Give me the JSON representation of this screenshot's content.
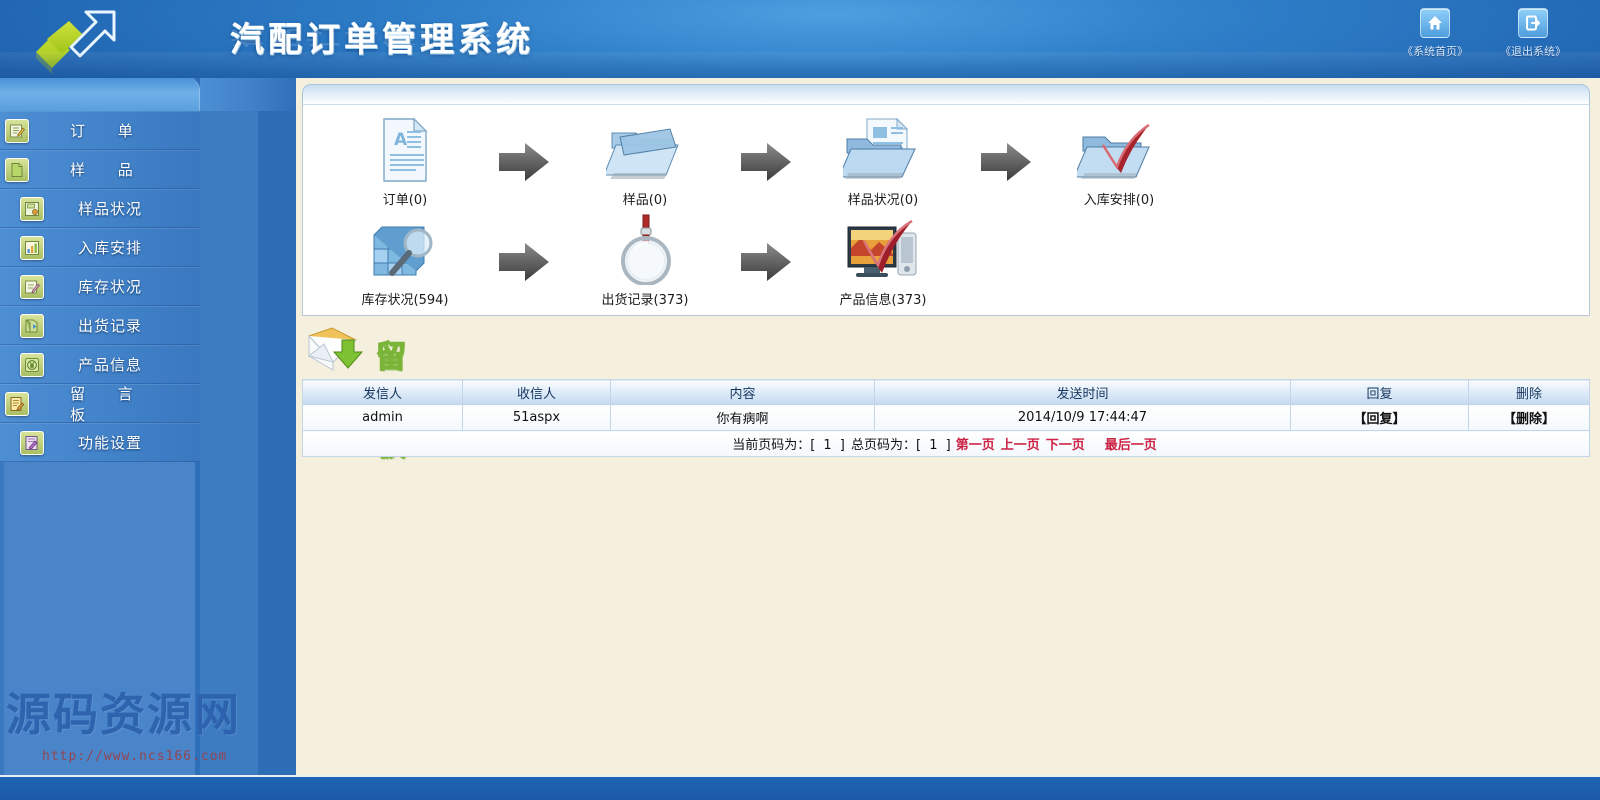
{
  "header": {
    "title": "汽配订单管理系统",
    "logo_icon": "arrow-exchange-logo",
    "tools": [
      {
        "icon": "home-icon",
        "label": "《系统首页》"
      },
      {
        "icon": "logout-icon",
        "label": "《退出系统》"
      }
    ]
  },
  "sidebar": {
    "items": [
      {
        "label": "订  单",
        "icon": "pencil-note-icon",
        "level": 1
      },
      {
        "label": "样  品",
        "icon": "green-page-icon",
        "level": 1
      },
      {
        "label": "样品状况",
        "icon": "report-save-icon",
        "level": 2
      },
      {
        "label": "入库安排",
        "icon": "bar-chart-icon",
        "level": 2
      },
      {
        "label": "库存状况",
        "icon": "pencil-edit-icon",
        "level": 2
      },
      {
        "label": "出货记录",
        "icon": "outbox-box-icon",
        "level": 2
      },
      {
        "label": "产品信息",
        "icon": "yen-coin-icon",
        "level": 2
      },
      {
        "label": "留 言 板",
        "icon": "notepad-pen-icon",
        "level": 1
      },
      {
        "label": "功能设置",
        "icon": "settings-tool-icon",
        "level": 2
      }
    ],
    "watermark": {
      "text": "源码资源网",
      "url": "http://www.ncs166.com"
    }
  },
  "workflow": {
    "row1": [
      {
        "label": "订单(0)",
        "icon": "document-a-icon"
      },
      {
        "label": "样品(0)",
        "icon": "blue-folder-icon"
      },
      {
        "label": "样品状况(0)",
        "icon": "folder-document-icon"
      },
      {
        "label": "入库安排(0)",
        "icon": "folder-check-icon"
      }
    ],
    "row2": [
      {
        "label": "库存状况(594)",
        "icon": "database-search-icon"
      },
      {
        "label": "出货记录(373)",
        "icon": "magnifier-icon"
      },
      {
        "label": "产品信息(373)",
        "icon": "monitor-check-icon"
      }
    ],
    "arrow_icon": "right-arrow-icon"
  },
  "message_board": {
    "title": "留言板",
    "title_icon": "envelope-download-icon",
    "columns": [
      "发信人",
      "收信人",
      "内容",
      "发送时间",
      "回复",
      "删除"
    ],
    "rows": [
      {
        "sender": "admin",
        "receiver": "51aspx",
        "content": "你有病啊",
        "time": "2014/10/9 17:44:47",
        "reply": "【回复】",
        "delete": "【删除】"
      }
    ],
    "pager": {
      "current_label": "当前页码为：",
      "current_value": "[ 1 ]",
      "total_label": "总页码为：",
      "total_value": "[ 1 ]",
      "first": "第一页",
      "prev": "上一页",
      "next": "下一页",
      "last": "最后一页"
    }
  },
  "colors": {
    "header_blue": "#2f7fc9",
    "sidebar_blue": "#3f7fc6",
    "content_cream": "#f5efdd",
    "accent_red": "#cc2244",
    "link_dark_blue": "#14407f",
    "title_green": "#7ab53a"
  }
}
